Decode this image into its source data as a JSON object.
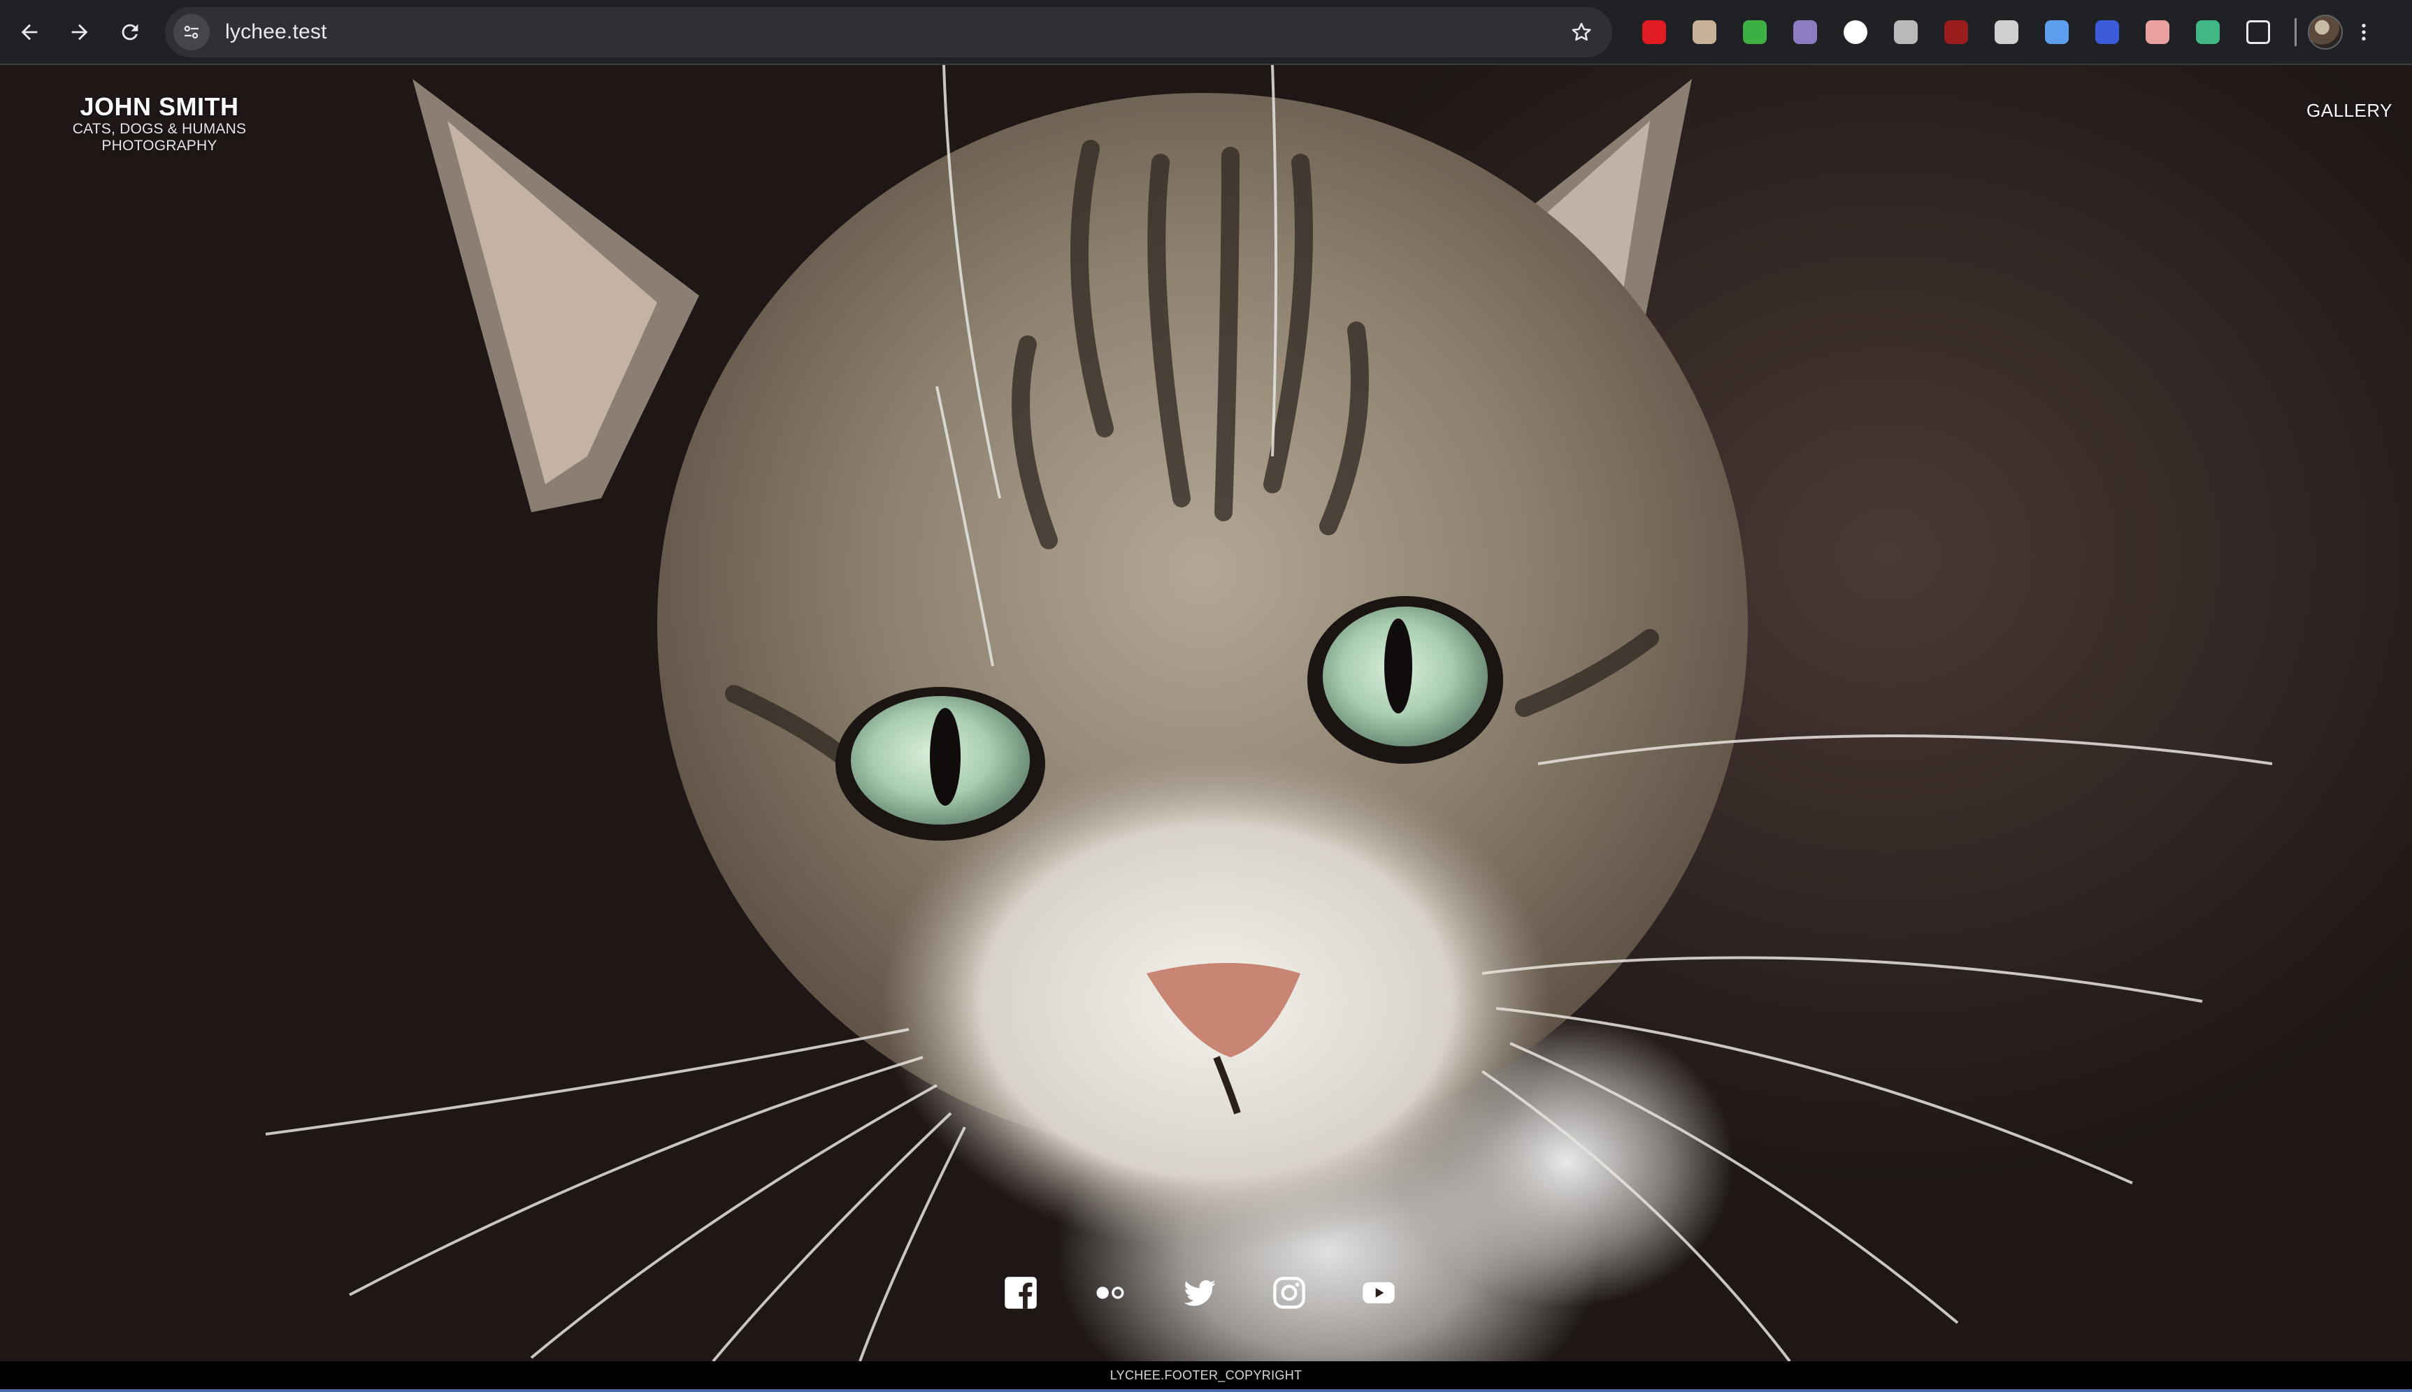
{
  "browser": {
    "url": "lychee.test",
    "extensions": [
      {
        "name": "adblock-icon",
        "color": "#e01b24"
      },
      {
        "name": "extension-2-icon",
        "color": "#c7b299"
      },
      {
        "name": "extension-3-icon",
        "color": "#3cb043"
      },
      {
        "name": "extension-4-icon",
        "color": "#8e7cc3"
      },
      {
        "name": "extension-5-icon",
        "color": "#ffffff"
      },
      {
        "name": "extension-6-icon",
        "color": "#b9b9b9"
      },
      {
        "name": "ublock-icon",
        "color": "#9b1c1c"
      },
      {
        "name": "shield-icon",
        "color": "#cfcfcf"
      },
      {
        "name": "extension-9-icon",
        "color": "#5c9ded"
      },
      {
        "name": "extension-10-icon",
        "color": "#3b5bdb"
      },
      {
        "name": "extension-11-icon",
        "color": "#e8a0a0"
      },
      {
        "name": "vue-devtools-icon",
        "color": "#41b883"
      },
      {
        "name": "extensions-puzzle-icon",
        "color": "#e8eaed"
      }
    ]
  },
  "site": {
    "title": "JOHN SMITH",
    "subtitle": "CATS, DOGS & HUMANS PHOTOGRAPHY",
    "nav_gallery": "GALLERY",
    "footer": "LYCHEE.FOOTER_COPYRIGHT",
    "socials": [
      "facebook-icon",
      "flickr-icon",
      "twitter-icon",
      "instagram-icon",
      "youtube-icon"
    ]
  }
}
